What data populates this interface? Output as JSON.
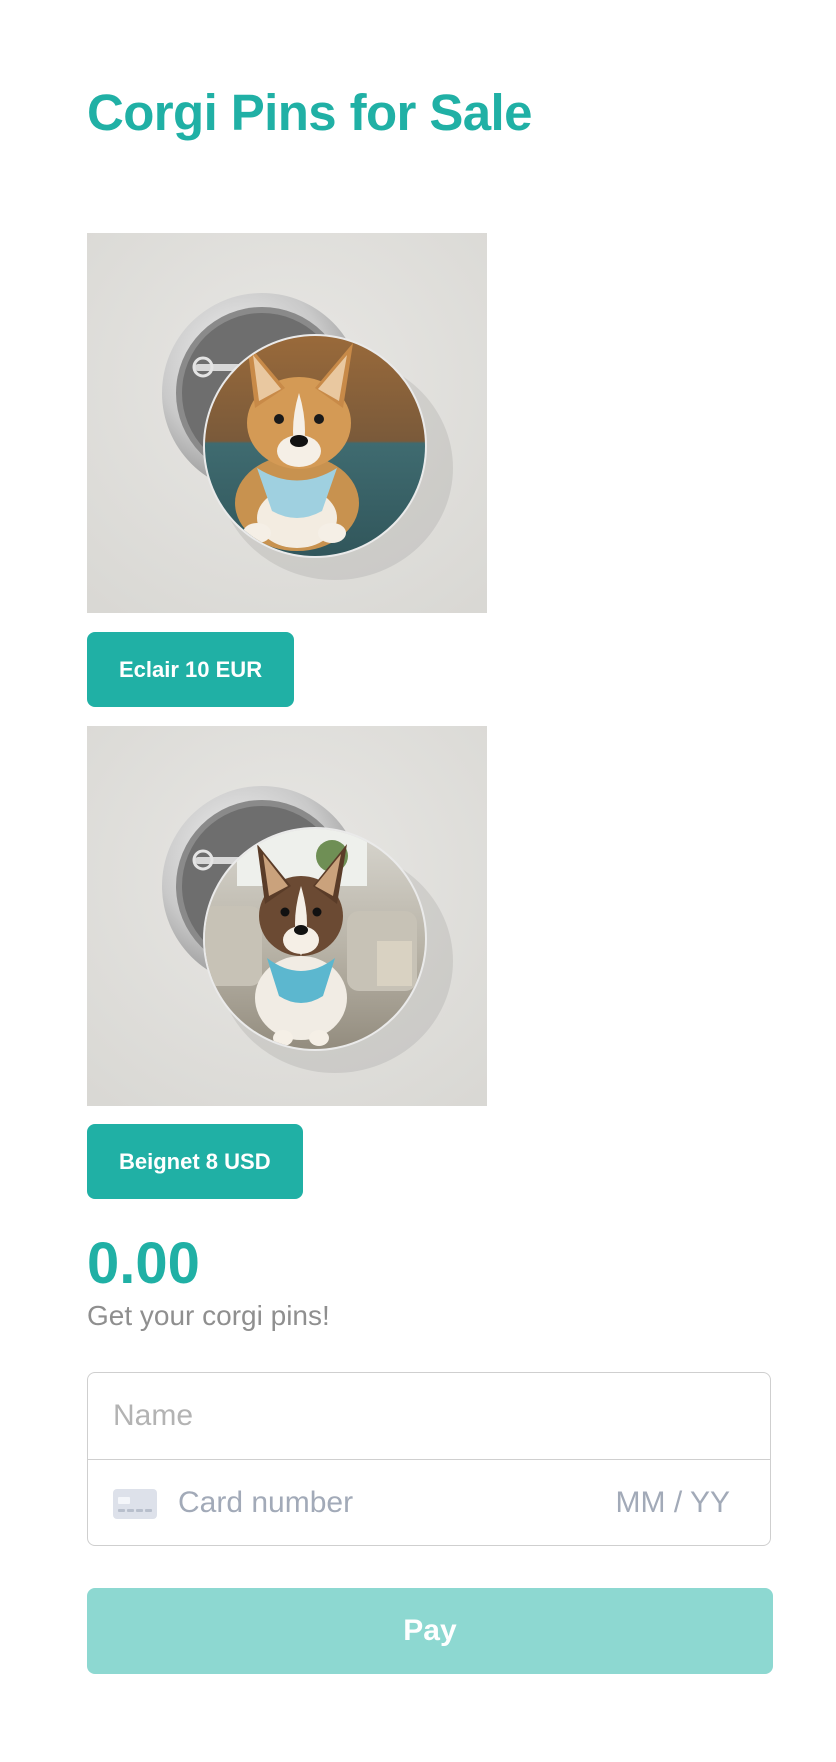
{
  "header": {
    "title": "Corgi Pins for Sale"
  },
  "products": [
    {
      "name": "Eclair",
      "button_label": "Eclair 10 EUR",
      "image_icon": "corgi-pin-eclair-image"
    },
    {
      "name": "Beignet",
      "button_label": "Beignet 8 USD",
      "image_icon": "corgi-pin-beignet-image"
    }
  ],
  "checkout": {
    "total": "0.00",
    "subtitle": "Get your corgi pins!",
    "name_placeholder": "Name",
    "card_number_placeholder": "Card number",
    "card_expiry_placeholder": "MM / YY",
    "card_icon": "credit-card-icon",
    "pay_label": "Pay"
  },
  "colors": {
    "accent": "#20b0a5",
    "pay_disabled": "#8dd8d1",
    "muted_text": "#8f8f8f",
    "border": "#cfcfcf"
  }
}
